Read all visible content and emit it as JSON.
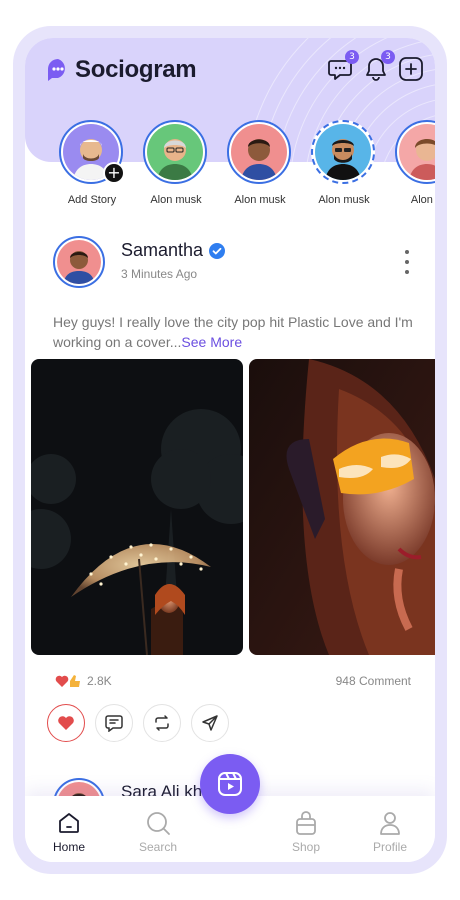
{
  "app": {
    "name": "Sociogram"
  },
  "header": {
    "messages_badge": "3",
    "notifications_badge": "3"
  },
  "stories": [
    {
      "name": "Add Story",
      "bg": "#9a8bf0",
      "skin": "#e7b98f",
      "outfit": "#f4f4f4",
      "hat": true
    },
    {
      "name": "Alon musk",
      "bg": "#67c77a",
      "skin": "#e8b48a",
      "outfit": "#3b7a44",
      "hat": false
    },
    {
      "name": "Alon musk",
      "bg": "#f08f8f",
      "skin": "#8d5a3b",
      "outfit": "#2f4fa3",
      "hat": false
    },
    {
      "name": "Alon musk",
      "bg": "#58b5e8",
      "skin": "#c98c5f",
      "outfit": "#111111",
      "hat": false
    },
    {
      "name": "Alon m",
      "bg": "#f4a7a7",
      "skin": "#e9b693",
      "outfit": "#cc5b5b",
      "hat": false
    }
  ],
  "post": {
    "author": "Samantha",
    "time": "3 Minutes Ago",
    "caption": "Hey guys! I really  love the city pop hit Plastic  Love and I'm working on a cover...",
    "see_more": "See More",
    "reaction_count": "2.8K",
    "comment_count": "948 Comment"
  },
  "next_post": {
    "author": "Sara Ali kh"
  },
  "nav": {
    "home": "Home",
    "search": "Search",
    "shop": "Shop",
    "profile": "Profile"
  },
  "colors": {
    "accent": "#7b5cf2",
    "ring": "#3b6fe3",
    "like": "#e24c4c"
  },
  "icons": [
    "chat-bubble-icon",
    "bell-icon",
    "add-square-icon",
    "more-vertical-icon",
    "heart-icon",
    "comment-icon",
    "repost-icon",
    "send-icon",
    "home-icon",
    "search-icon",
    "reels-icon",
    "shop-bag-icon",
    "profile-icon",
    "verified-icon"
  ]
}
